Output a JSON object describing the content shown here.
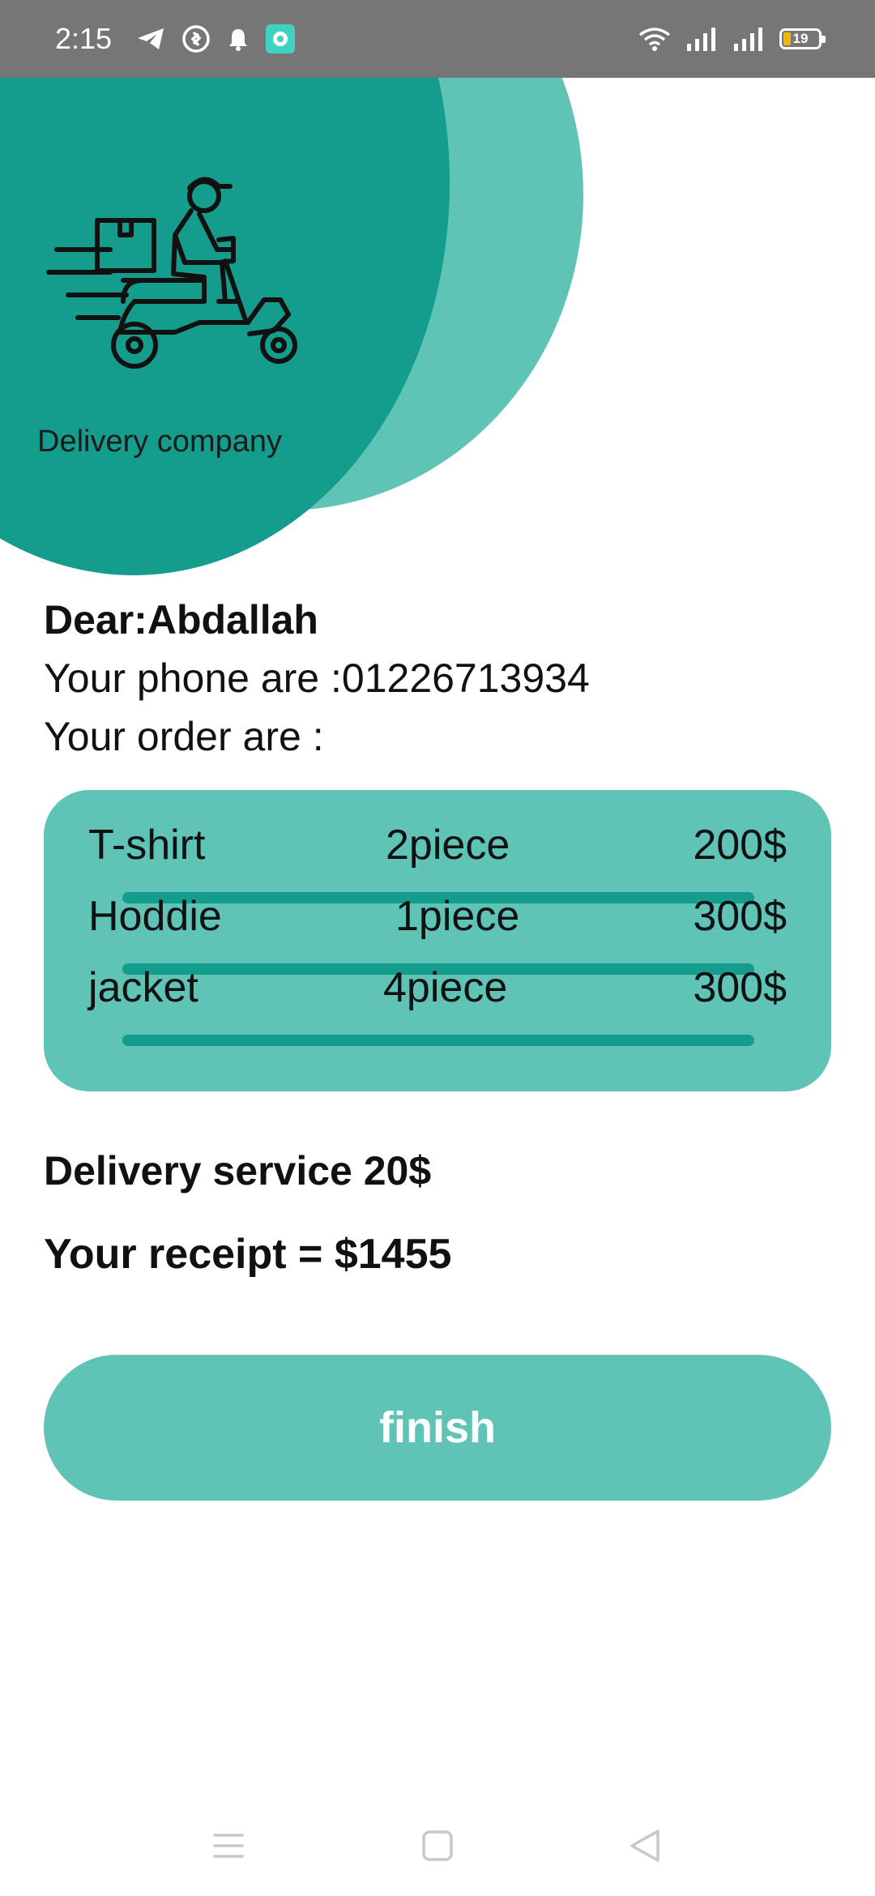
{
  "status_bar": {
    "time": "2:15",
    "battery_level": "19",
    "icons_left": [
      "telegram-icon",
      "shazam-icon",
      "notification-bell-icon",
      "app-badge-icon"
    ],
    "icons_right": [
      "wifi-icon",
      "signal-bars-icon",
      "signal-bars-icon",
      "battery-icon"
    ]
  },
  "header": {
    "company_name": "Delivery company",
    "logo_icon": "delivery-scooter-icon",
    "colors": {
      "dark": "#149c8c",
      "light": "#5fc3b6"
    }
  },
  "customer": {
    "greeting": "Dear:Abdallah",
    "phone": "Your phone are :01226713934",
    "order_label": "Your order are :"
  },
  "order_items": [
    {
      "name": "T-shirt",
      "quantity": "2piece",
      "price": "200$"
    },
    {
      "name": "Hoddie",
      "quantity": "1piece",
      "price": "300$"
    },
    {
      "name": "jacket",
      "quantity": "4piece",
      "price": "300$"
    }
  ],
  "summary": {
    "delivery_service": "Delivery service 20$",
    "receipt": "Your receipt = $1455"
  },
  "actions": {
    "finish_label": "finish"
  },
  "navigation": {
    "buttons": [
      "menu-icon",
      "home-icon",
      "back-icon"
    ]
  }
}
